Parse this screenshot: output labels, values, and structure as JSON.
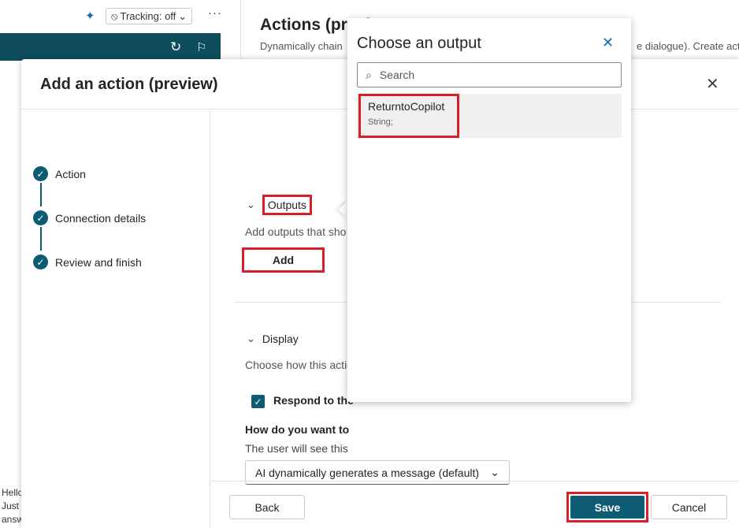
{
  "background": {
    "tracking_label": "Tracking: off",
    "page_title": "Actions (previ",
    "page_desc": "Dynamically chain",
    "page_desc_right": "e dialogue). Create act",
    "chat_lines": [
      "Hello",
      "Just",
      "answ"
    ]
  },
  "dialog": {
    "title": "Add an action (preview)",
    "steps": [
      {
        "label": "Action"
      },
      {
        "label": "Connection details"
      },
      {
        "label": "Review and finish"
      }
    ],
    "outputs": {
      "heading": "Outputs",
      "description": "Add outputs that sho",
      "add_label": "Add"
    },
    "display": {
      "heading": "Display",
      "description": "Choose how this actio",
      "checkbox_label": "Respond to the",
      "checkbox_checked": true,
      "question": "How do you want to",
      "help": "The user will see this",
      "select_value": "AI dynamically generates a message (default)"
    },
    "footer": {
      "back_label": "Back",
      "save_label": "Save",
      "cancel_label": "Cancel"
    }
  },
  "flyout": {
    "title": "Choose an output",
    "search_placeholder": "Search",
    "items": [
      {
        "name": "ReturntoCopilot",
        "type": "String;"
      }
    ]
  },
  "colors": {
    "accent": "#0d5c73",
    "highlight": "#d9202a",
    "link": "#0f6cbd"
  },
  "icons": [
    "sparkle-icon",
    "more-icon",
    "refresh-icon",
    "flag-icon",
    "close-icon",
    "check-icon",
    "chevron-down-icon",
    "search-icon"
  ]
}
